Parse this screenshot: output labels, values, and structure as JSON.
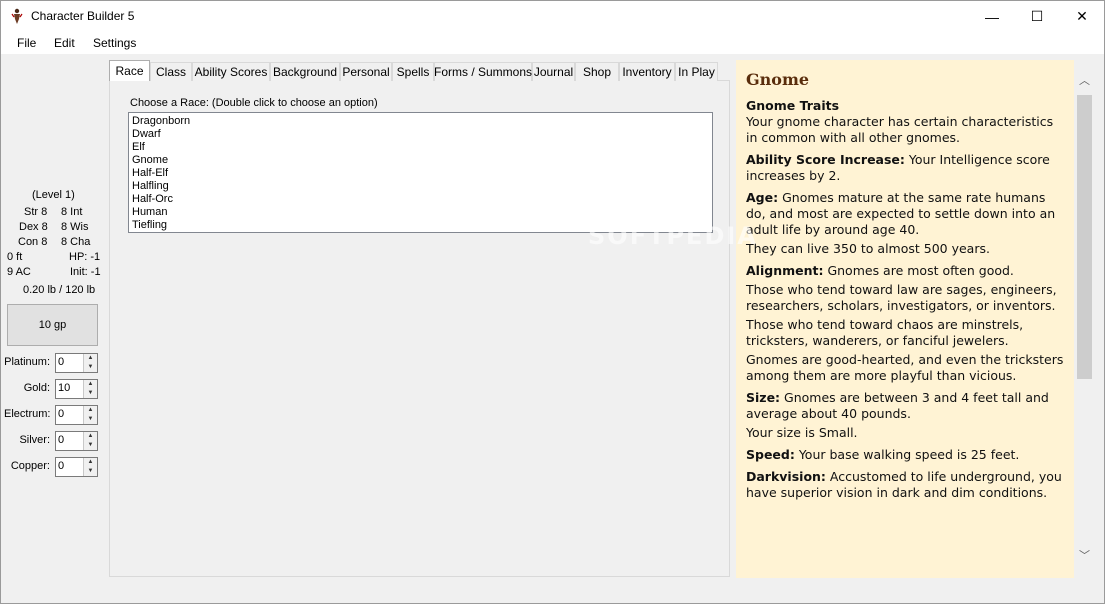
{
  "window": {
    "title": "Character Builder 5",
    "controls": {
      "minimize": "—",
      "maximize": "☐",
      "close": "✕"
    }
  },
  "menu": [
    "File",
    "Edit",
    "Settings"
  ],
  "stats": {
    "level": "(Level 1)",
    "str": "Str 8",
    "int": "8 Int",
    "dex": "Dex 8",
    "wis": "8 Wis",
    "con": "Con 8",
    "cha": "8 Cha",
    "speed": "0 ft",
    "hp": "HP: -1",
    "ac": "9 AC",
    "init": "Init: -1",
    "weight": "0.20 lb / 120 lb"
  },
  "gold_total": "10 gp",
  "coins": [
    {
      "label": "Platinum:",
      "value": "0"
    },
    {
      "label": "Gold:",
      "value": "10"
    },
    {
      "label": "Electrum:",
      "value": "0"
    },
    {
      "label": "Silver:",
      "value": "0"
    },
    {
      "label": "Copper:",
      "value": "0"
    }
  ],
  "tabs": [
    "Race",
    "Class",
    "Ability Scores",
    "Background",
    "Personal",
    "Spells",
    "Forms / Summons",
    "Journal",
    "Shop",
    "Inventory",
    "In Play"
  ],
  "active_tab": "Race",
  "race_prompt": "Choose a Race: (Double click to choose an option)",
  "races": [
    "Dragonborn",
    "Dwarf",
    "Elf",
    "Gnome",
    "Half-Elf",
    "Halfling",
    "Half-Orc",
    "Human",
    "Tiefling"
  ],
  "watermark": "SOFTPEDIA",
  "description": {
    "title": "Gnome",
    "traits_heading": "Gnome Traits",
    "traits_intro": "Your gnome character has certain characteristics in common with all other gnomes.",
    "paragraphs": [
      {
        "label": "Ability Score Increase:",
        "text": " Your Intelligence score increases by 2."
      },
      {
        "label": "Age:",
        "text": " Gnomes mature at the same rate humans do, and most are expected to settle down into an adult life by around age 40."
      },
      {
        "label": "",
        "text": "They can live 350 to almost 500 years."
      },
      {
        "label": "Alignment:",
        "text": " Gnomes are most often good."
      },
      {
        "label": "",
        "text": "Those who tend toward law are sages, engineers, researchers, scholars, investigators, or inventors."
      },
      {
        "label": "",
        "text": "Those who tend toward chaos are minstrels, tricksters, wanderers, or fanciful jewelers."
      },
      {
        "label": "",
        "text": "Gnomes are good-hearted, and even the tricksters among them are more playful than vicious."
      },
      {
        "label": "Size:",
        "text": " Gnomes are between 3 and 4 feet tall and average about 40 pounds."
      },
      {
        "label": "",
        "text": "Your size is Small."
      },
      {
        "label": "Speed:",
        "text": " Your base walking speed is 25 feet."
      },
      {
        "label": "Darkvision:",
        "text": " Accustomed to life underground, you have superior vision in dark and dim conditions."
      }
    ]
  },
  "colors": {
    "desc_background": "#fff3d4",
    "desc_title": "#5a2d0c"
  }
}
